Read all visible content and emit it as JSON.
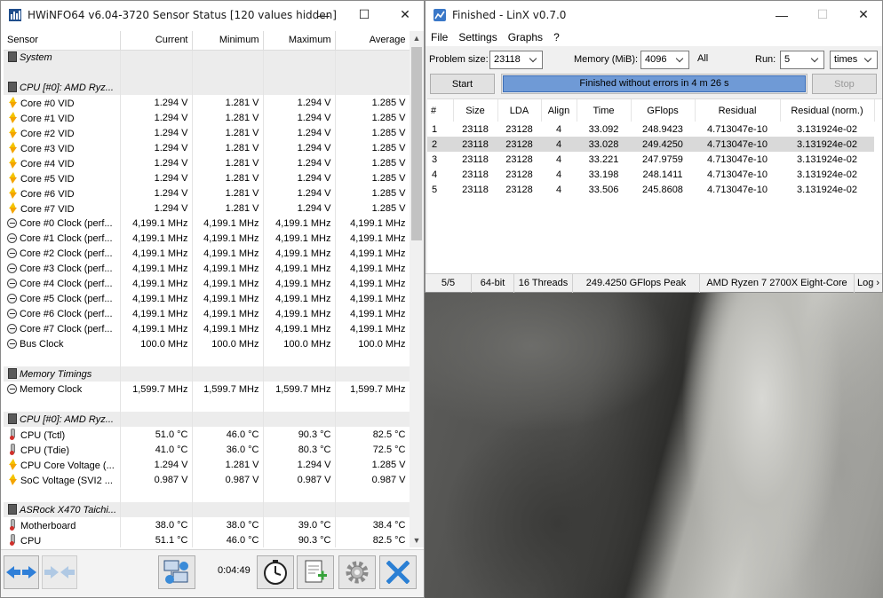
{
  "hwinfo": {
    "title": "HWiNFO64 v6.04-3720 Sensor Status [120 values hidden]",
    "columns": [
      "Sensor",
      "Current",
      "Minimum",
      "Maximum",
      "Average"
    ],
    "rows": [
      {
        "kind": "group",
        "icon": "chip",
        "label": "System"
      },
      {
        "kind": "spacer"
      },
      {
        "kind": "group",
        "icon": "chip",
        "label": "CPU [#0]: AMD Ryz..."
      },
      {
        "kind": "data",
        "icon": "bolt",
        "label": "Core #0 VID",
        "cur": "1.294 V",
        "min": "1.281 V",
        "max": "1.294 V",
        "avg": "1.285 V"
      },
      {
        "kind": "data",
        "icon": "bolt",
        "label": "Core #1 VID",
        "cur": "1.294 V",
        "min": "1.281 V",
        "max": "1.294 V",
        "avg": "1.285 V"
      },
      {
        "kind": "data",
        "icon": "bolt",
        "label": "Core #2 VID",
        "cur": "1.294 V",
        "min": "1.281 V",
        "max": "1.294 V",
        "avg": "1.285 V"
      },
      {
        "kind": "data",
        "icon": "bolt",
        "label": "Core #3 VID",
        "cur": "1.294 V",
        "min": "1.281 V",
        "max": "1.294 V",
        "avg": "1.285 V"
      },
      {
        "kind": "data",
        "icon": "bolt",
        "label": "Core #4 VID",
        "cur": "1.294 V",
        "min": "1.281 V",
        "max": "1.294 V",
        "avg": "1.285 V"
      },
      {
        "kind": "data",
        "icon": "bolt",
        "label": "Core #5 VID",
        "cur": "1.294 V",
        "min": "1.281 V",
        "max": "1.294 V",
        "avg": "1.285 V"
      },
      {
        "kind": "data",
        "icon": "bolt",
        "label": "Core #6 VID",
        "cur": "1.294 V",
        "min": "1.281 V",
        "max": "1.294 V",
        "avg": "1.285 V"
      },
      {
        "kind": "data",
        "icon": "bolt",
        "label": "Core #7 VID",
        "cur": "1.294 V",
        "min": "1.281 V",
        "max": "1.294 V",
        "avg": "1.285 V"
      },
      {
        "kind": "data",
        "icon": "clock",
        "label": "Core #0 Clock (perf...",
        "cur": "4,199.1 MHz",
        "min": "4,199.1 MHz",
        "max": "4,199.1 MHz",
        "avg": "4,199.1 MHz"
      },
      {
        "kind": "data",
        "icon": "clock",
        "label": "Core #1 Clock (perf...",
        "cur": "4,199.1 MHz",
        "min": "4,199.1 MHz",
        "max": "4,199.1 MHz",
        "avg": "4,199.1 MHz"
      },
      {
        "kind": "data",
        "icon": "clock",
        "label": "Core #2 Clock (perf...",
        "cur": "4,199.1 MHz",
        "min": "4,199.1 MHz",
        "max": "4,199.1 MHz",
        "avg": "4,199.1 MHz"
      },
      {
        "kind": "data",
        "icon": "clock",
        "label": "Core #3 Clock (perf...",
        "cur": "4,199.1 MHz",
        "min": "4,199.1 MHz",
        "max": "4,199.1 MHz",
        "avg": "4,199.1 MHz"
      },
      {
        "kind": "data",
        "icon": "clock",
        "label": "Core #4 Clock (perf...",
        "cur": "4,199.1 MHz",
        "min": "4,199.1 MHz",
        "max": "4,199.1 MHz",
        "avg": "4,199.1 MHz"
      },
      {
        "kind": "data",
        "icon": "clock",
        "label": "Core #5 Clock (perf...",
        "cur": "4,199.1 MHz",
        "min": "4,199.1 MHz",
        "max": "4,199.1 MHz",
        "avg": "4,199.1 MHz"
      },
      {
        "kind": "data",
        "icon": "clock",
        "label": "Core #6 Clock (perf...",
        "cur": "4,199.1 MHz",
        "min": "4,199.1 MHz",
        "max": "4,199.1 MHz",
        "avg": "4,199.1 MHz"
      },
      {
        "kind": "data",
        "icon": "clock",
        "label": "Core #7 Clock (perf...",
        "cur": "4,199.1 MHz",
        "min": "4,199.1 MHz",
        "max": "4,199.1 MHz",
        "avg": "4,199.1 MHz"
      },
      {
        "kind": "data",
        "icon": "clock",
        "label": "Bus Clock",
        "cur": "100.0 MHz",
        "min": "100.0 MHz",
        "max": "100.0 MHz",
        "avg": "100.0 MHz"
      },
      {
        "kind": "blank"
      },
      {
        "kind": "group",
        "icon": "chip",
        "label": "Memory Timings"
      },
      {
        "kind": "data",
        "icon": "clock",
        "label": "Memory Clock",
        "cur": "1,599.7 MHz",
        "min": "1,599.7 MHz",
        "max": "1,599.7 MHz",
        "avg": "1,599.7 MHz"
      },
      {
        "kind": "blank"
      },
      {
        "kind": "group",
        "icon": "chip",
        "label": "CPU [#0]: AMD Ryz..."
      },
      {
        "kind": "data",
        "icon": "therm",
        "label": "CPU (Tctl)",
        "cur": "51.0 °C",
        "min": "46.0 °C",
        "max": "90.3 °C",
        "avg": "82.5 °C"
      },
      {
        "kind": "data",
        "icon": "therm",
        "label": "CPU (Tdie)",
        "cur": "41.0 °C",
        "min": "36.0 °C",
        "max": "80.3 °C",
        "avg": "72.5 °C"
      },
      {
        "kind": "data",
        "icon": "bolt",
        "label": "CPU Core Voltage (...",
        "cur": "1.294 V",
        "min": "1.281 V",
        "max": "1.294 V",
        "avg": "1.285 V"
      },
      {
        "kind": "data",
        "icon": "bolt",
        "label": "SoC Voltage (SVI2 ...",
        "cur": "0.987 V",
        "min": "0.987 V",
        "max": "0.987 V",
        "avg": "0.987 V"
      },
      {
        "kind": "blank"
      },
      {
        "kind": "group",
        "icon": "chip",
        "label": "ASRock X470 Taichi..."
      },
      {
        "kind": "data",
        "icon": "therm",
        "label": "Motherboard",
        "cur": "38.0 °C",
        "min": "38.0 °C",
        "max": "39.0 °C",
        "avg": "38.4 °C"
      },
      {
        "kind": "data",
        "icon": "therm",
        "label": "CPU",
        "cur": "51.1 °C",
        "min": "46.0 °C",
        "max": "90.3 °C",
        "avg": "82.5 °C"
      }
    ],
    "timer": "0:04:49"
  },
  "linx": {
    "title": "Finished - LinX v0.7.0",
    "menu": [
      "File",
      "Settings",
      "Graphs",
      "?"
    ],
    "problem_size_label": "Problem size:",
    "problem_size": "23118",
    "memory_label": "Memory (MiB):",
    "memory": "4096",
    "all_label": "All",
    "run_label": "Run:",
    "run": "5",
    "run_unit": "times",
    "start_label": "Start",
    "stop_label": "Stop",
    "progress_text": "Finished without errors in 4 m 26 s",
    "progress": 1.0,
    "columns": [
      "#",
      "Size",
      "LDA",
      "Align",
      "Time",
      "GFlops",
      "Residual",
      "Residual (norm.)"
    ],
    "results": [
      [
        "1",
        "23118",
        "23128",
        "4",
        "33.092",
        "248.9423",
        "4.713047e-10",
        "3.131924e-02"
      ],
      [
        "2",
        "23118",
        "23128",
        "4",
        "33.028",
        "249.4250",
        "4.713047e-10",
        "3.131924e-02"
      ],
      [
        "3",
        "23118",
        "23128",
        "4",
        "33.221",
        "247.9759",
        "4.713047e-10",
        "3.131924e-02"
      ],
      [
        "4",
        "23118",
        "23128",
        "4",
        "33.198",
        "248.1411",
        "4.713047e-10",
        "3.131924e-02"
      ],
      [
        "5",
        "23118",
        "23128",
        "4",
        "33.506",
        "245.8608",
        "4.713047e-10",
        "3.131924e-02"
      ]
    ],
    "selected_row": 1,
    "status": [
      "5/5",
      "64-bit",
      "16 Threads",
      "249.4250 GFlops Peak",
      "AMD Ryzen 7 2700X Eight-Core",
      "Log ›"
    ]
  }
}
